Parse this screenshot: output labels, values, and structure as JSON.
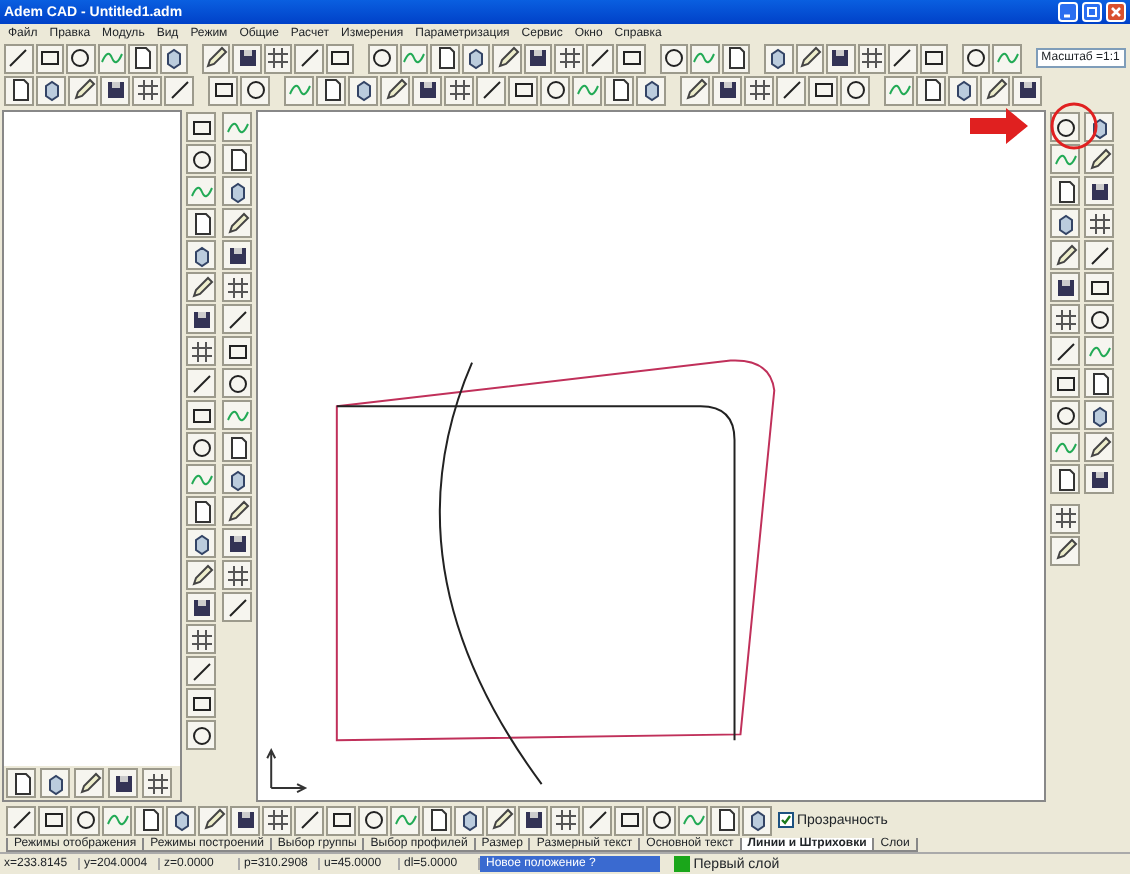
{
  "window": {
    "title": "Adem CAD - Untitled1.adm"
  },
  "menu": [
    "Файл",
    "Правка",
    "Модуль",
    "Вид",
    "Режим",
    "Общие",
    "Расчет",
    "Измерения",
    "Параметризация",
    "Сервис",
    "Окно",
    "Справка"
  ],
  "scale_field": {
    "value": "Масштаб =1:1"
  },
  "transparency": {
    "label": "Прозрачность",
    "checked": true
  },
  "tabs": [
    {
      "label": "Режимы отображения",
      "selected": false
    },
    {
      "label": "Режимы построений",
      "selected": false
    },
    {
      "label": "Выбор группы",
      "selected": false
    },
    {
      "label": "Выбор профилей",
      "selected": false
    },
    {
      "label": "Размер",
      "selected": false
    },
    {
      "label": "Размерный текст",
      "selected": false
    },
    {
      "label": "Основной текст",
      "selected": false
    },
    {
      "label": "Линии и Штриховки",
      "selected": true
    },
    {
      "label": "Слои",
      "selected": false
    }
  ],
  "status_bar": {
    "coords": [
      "x=233.8145",
      "y=204.0004",
      "z=0.0000",
      "p=310.2908",
      "u=45.0000",
      "dl=5.0000"
    ],
    "prompt": "Новое положение ?",
    "layer": {
      "name": "Первый слой",
      "color": "#1aa61a"
    }
  }
}
